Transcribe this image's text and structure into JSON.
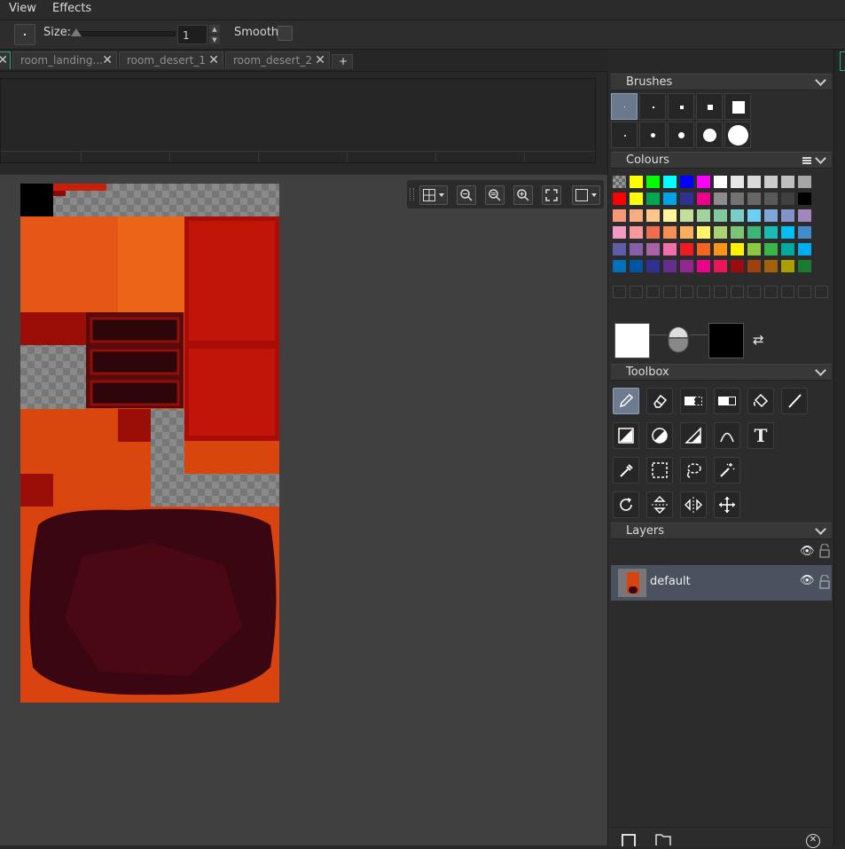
{
  "menubar": {
    "items": [
      "View",
      "Effects"
    ]
  },
  "toolbar": {
    "size_label": "Size:",
    "size_value": "1",
    "spin_up": "▲",
    "spin_down": "▼",
    "smooth_label": "Smooth",
    "smooth_checked": false,
    "slider_level": 0.0
  },
  "tabs": {
    "items": [
      {
        "label": "room_landing..."
      },
      {
        "label": "room_desert_1"
      },
      {
        "label": "room_desert_2"
      }
    ],
    "close_glyph": "✕",
    "add_label": "+"
  },
  "brushes": {
    "title": "Brushes"
  },
  "colours": {
    "title": "Colours",
    "primary": "#ffffff",
    "secondary": "#000000",
    "rows": [
      [
        "transparent",
        "#ffff00",
        "#00ff00",
        "#00ffff",
        "#0000ff",
        "#ff00ff",
        "#ffffff",
        "#e6e6e6",
        "#d9d9d9",
        "#cccccc",
        "#bfbfbf",
        "#a6a6a6"
      ],
      [
        "#ff0000",
        "#ffff00",
        "#00a650",
        "#00a2e8",
        "#2e3192",
        "#ec008c",
        "#8c8c8c",
        "#737373",
        "#666666",
        "#595959",
        "#404040",
        "#000000"
      ],
      [
        "#f7977a",
        "#f9ad81",
        "#fdc68a",
        "#fff79a",
        "#c4df9b",
        "#a2d39c",
        "#82ca9d",
        "#7bcdc8",
        "#6ecff6",
        "#7ea7d8",
        "#8493ca",
        "#a187be"
      ],
      [
        "#f49ac2",
        "#f6989d",
        "#f26c4f",
        "#f68e55",
        "#fbaf5c",
        "#fff467",
        "#acd372",
        "#7cc576",
        "#3bb878",
        "#1abbb4",
        "#00bff3",
        "#438ccb"
      ],
      [
        "#605ca8",
        "#855fa8",
        "#a763a8",
        "#f06ea9",
        "#ed1c24",
        "#f26522",
        "#f7941d",
        "#fff200",
        "#8dc73f",
        "#39b54a",
        "#00a99d",
        "#00aeef"
      ],
      [
        "#0072bc",
        "#0054a6",
        "#2e3192",
        "#662d91",
        "#92278f",
        "#ec008c",
        "#ed145b",
        "#9e0b0f",
        "#a0410d",
        "#a36209",
        "#aba000",
        "#197b30"
      ]
    ]
  },
  "toolbox": {
    "title": "Toolbox"
  },
  "layers": {
    "title": "Layers",
    "items": [
      {
        "name": "default"
      }
    ]
  },
  "canvas": {
    "colors": {
      "sand": "#e05012",
      "deep_red": "#c21808",
      "dark": "#3a0611",
      "checker_a": "#8e8e8e",
      "checker_b": "#7a7a7a"
    }
  }
}
